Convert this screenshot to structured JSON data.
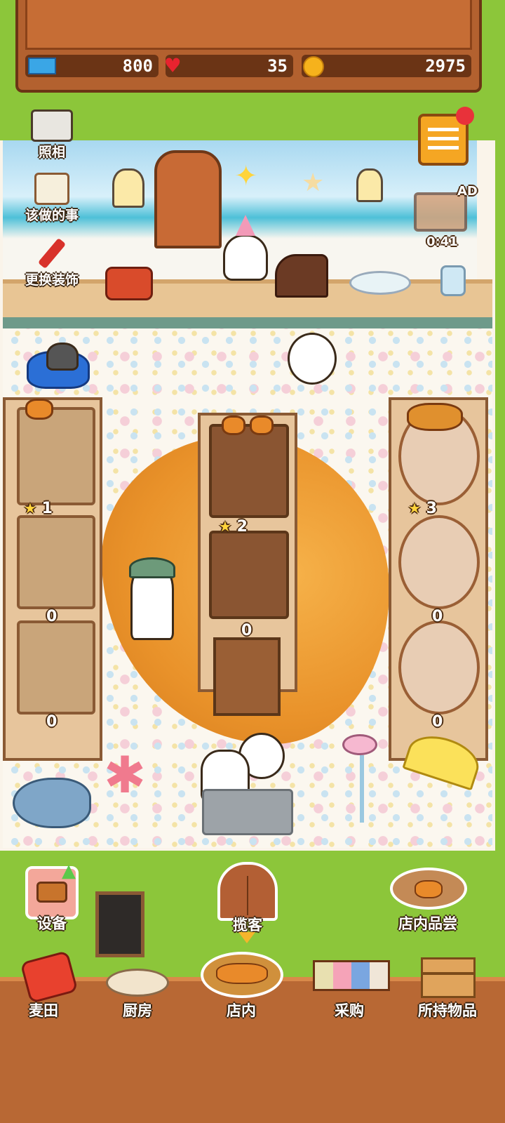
{
  "resources": {
    "tickets": "800",
    "hearts": "35",
    "coins": "2975"
  },
  "side_menu": {
    "photo": "照相",
    "todo": "该做的事",
    "decor": "更换装饰"
  },
  "ad": {
    "badge": "AD",
    "timer": "0:41"
  },
  "shelves": {
    "left": {
      "level": "1",
      "counts": [
        "0",
        "0"
      ]
    },
    "middle": {
      "level": "2",
      "counts": [
        "0"
      ]
    },
    "right": {
      "level": "3",
      "counts": [
        "0",
        "0"
      ]
    }
  },
  "actions": {
    "equipment": "设备",
    "invite": "揽客",
    "tasting": "店内品尝"
  },
  "nav": {
    "field": "麦田",
    "kitchen": "厨房",
    "shop": "店内",
    "purchase": "采购",
    "items": "所持物品"
  },
  "colors": {
    "grass": "#8cc63a",
    "wood": "#b86834",
    "rug": "#e9922a"
  }
}
